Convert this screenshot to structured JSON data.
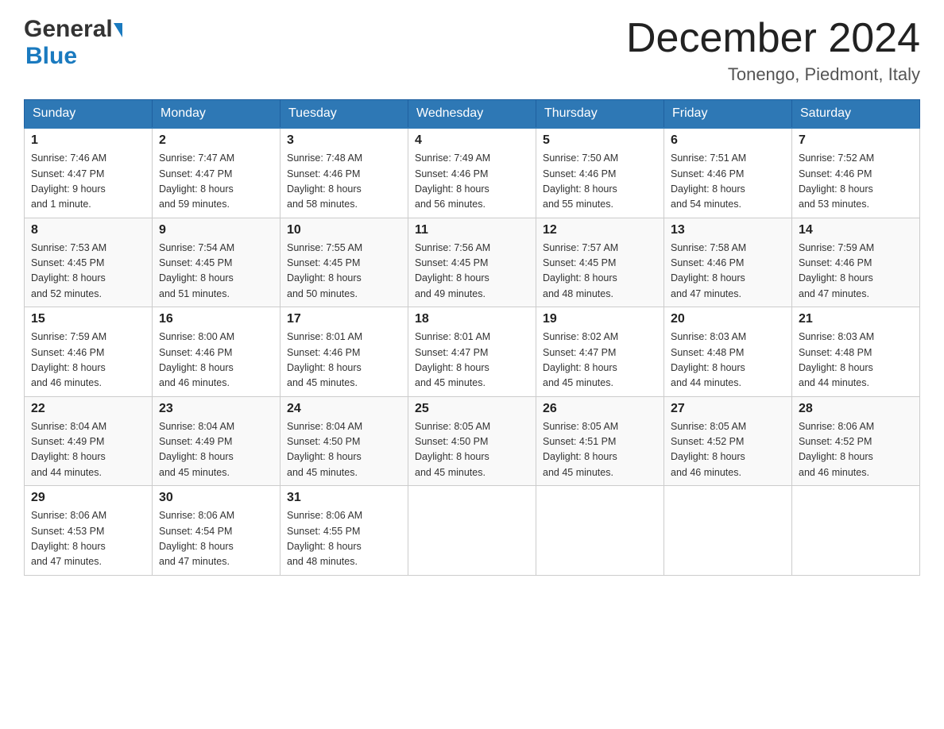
{
  "header": {
    "logo_general": "General",
    "logo_blue": "Blue",
    "month_title": "December 2024",
    "location": "Tonengo, Piedmont, Italy"
  },
  "days_of_week": [
    "Sunday",
    "Monday",
    "Tuesday",
    "Wednesday",
    "Thursday",
    "Friday",
    "Saturday"
  ],
  "weeks": [
    [
      {
        "day": "1",
        "sunrise": "7:46 AM",
        "sunset": "4:47 PM",
        "daylight": "9 hours and 1 minute."
      },
      {
        "day": "2",
        "sunrise": "7:47 AM",
        "sunset": "4:47 PM",
        "daylight": "8 hours and 59 minutes."
      },
      {
        "day": "3",
        "sunrise": "7:48 AM",
        "sunset": "4:46 PM",
        "daylight": "8 hours and 58 minutes."
      },
      {
        "day": "4",
        "sunrise": "7:49 AM",
        "sunset": "4:46 PM",
        "daylight": "8 hours and 56 minutes."
      },
      {
        "day": "5",
        "sunrise": "7:50 AM",
        "sunset": "4:46 PM",
        "daylight": "8 hours and 55 minutes."
      },
      {
        "day": "6",
        "sunrise": "7:51 AM",
        "sunset": "4:46 PM",
        "daylight": "8 hours and 54 minutes."
      },
      {
        "day": "7",
        "sunrise": "7:52 AM",
        "sunset": "4:46 PM",
        "daylight": "8 hours and 53 minutes."
      }
    ],
    [
      {
        "day": "8",
        "sunrise": "7:53 AM",
        "sunset": "4:45 PM",
        "daylight": "8 hours and 52 minutes."
      },
      {
        "day": "9",
        "sunrise": "7:54 AM",
        "sunset": "4:45 PM",
        "daylight": "8 hours and 51 minutes."
      },
      {
        "day": "10",
        "sunrise": "7:55 AM",
        "sunset": "4:45 PM",
        "daylight": "8 hours and 50 minutes."
      },
      {
        "day": "11",
        "sunrise": "7:56 AM",
        "sunset": "4:45 PM",
        "daylight": "8 hours and 49 minutes."
      },
      {
        "day": "12",
        "sunrise": "7:57 AM",
        "sunset": "4:45 PM",
        "daylight": "8 hours and 48 minutes."
      },
      {
        "day": "13",
        "sunrise": "7:58 AM",
        "sunset": "4:46 PM",
        "daylight": "8 hours and 47 minutes."
      },
      {
        "day": "14",
        "sunrise": "7:59 AM",
        "sunset": "4:46 PM",
        "daylight": "8 hours and 47 minutes."
      }
    ],
    [
      {
        "day": "15",
        "sunrise": "7:59 AM",
        "sunset": "4:46 PM",
        "daylight": "8 hours and 46 minutes."
      },
      {
        "day": "16",
        "sunrise": "8:00 AM",
        "sunset": "4:46 PM",
        "daylight": "8 hours and 46 minutes."
      },
      {
        "day": "17",
        "sunrise": "8:01 AM",
        "sunset": "4:46 PM",
        "daylight": "8 hours and 45 minutes."
      },
      {
        "day": "18",
        "sunrise": "8:01 AM",
        "sunset": "4:47 PM",
        "daylight": "8 hours and 45 minutes."
      },
      {
        "day": "19",
        "sunrise": "8:02 AM",
        "sunset": "4:47 PM",
        "daylight": "8 hours and 45 minutes."
      },
      {
        "day": "20",
        "sunrise": "8:03 AM",
        "sunset": "4:48 PM",
        "daylight": "8 hours and 44 minutes."
      },
      {
        "day": "21",
        "sunrise": "8:03 AM",
        "sunset": "4:48 PM",
        "daylight": "8 hours and 44 minutes."
      }
    ],
    [
      {
        "day": "22",
        "sunrise": "8:04 AM",
        "sunset": "4:49 PM",
        "daylight": "8 hours and 44 minutes."
      },
      {
        "day": "23",
        "sunrise": "8:04 AM",
        "sunset": "4:49 PM",
        "daylight": "8 hours and 45 minutes."
      },
      {
        "day": "24",
        "sunrise": "8:04 AM",
        "sunset": "4:50 PM",
        "daylight": "8 hours and 45 minutes."
      },
      {
        "day": "25",
        "sunrise": "8:05 AM",
        "sunset": "4:50 PM",
        "daylight": "8 hours and 45 minutes."
      },
      {
        "day": "26",
        "sunrise": "8:05 AM",
        "sunset": "4:51 PM",
        "daylight": "8 hours and 45 minutes."
      },
      {
        "day": "27",
        "sunrise": "8:05 AM",
        "sunset": "4:52 PM",
        "daylight": "8 hours and 46 minutes."
      },
      {
        "day": "28",
        "sunrise": "8:06 AM",
        "sunset": "4:52 PM",
        "daylight": "8 hours and 46 minutes."
      }
    ],
    [
      {
        "day": "29",
        "sunrise": "8:06 AM",
        "sunset": "4:53 PM",
        "daylight": "8 hours and 47 minutes."
      },
      {
        "day": "30",
        "sunrise": "8:06 AM",
        "sunset": "4:54 PM",
        "daylight": "8 hours and 47 minutes."
      },
      {
        "day": "31",
        "sunrise": "8:06 AM",
        "sunset": "4:55 PM",
        "daylight": "8 hours and 48 minutes."
      },
      null,
      null,
      null,
      null
    ]
  ],
  "labels": {
    "sunrise": "Sunrise:",
    "sunset": "Sunset:",
    "daylight": "Daylight:"
  }
}
